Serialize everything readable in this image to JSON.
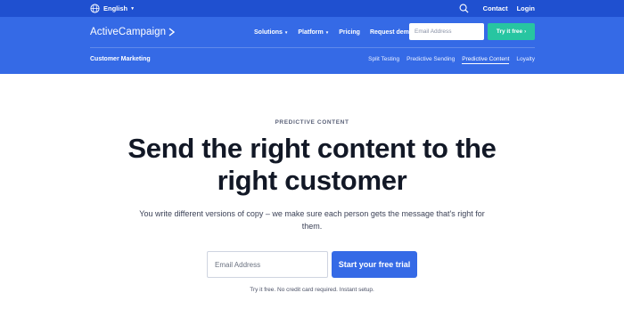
{
  "utility_bar": {
    "language": "English",
    "language_icon": "globe-icon",
    "search_icon": "search-icon",
    "links": [
      "Contact",
      "Login"
    ]
  },
  "header": {
    "logo_text": "ActiveCampaign",
    "logo_icon": "chevron-right-icon",
    "nav": [
      {
        "label": "Solutions",
        "has_dropdown": true
      },
      {
        "label": "Platform",
        "has_dropdown": true
      },
      {
        "label": "Pricing",
        "has_dropdown": false
      },
      {
        "label": "Request demo",
        "has_dropdown": false
      }
    ],
    "email_placeholder": "Email Address",
    "cta_label": "Try it free",
    "cta_arrow": "›"
  },
  "sub_header": {
    "section_title": "Customer Marketing",
    "items": [
      "Split Testing",
      "Predictive Sending",
      "Predictive Content",
      "Loyalty"
    ],
    "active_item": "Predictive Content"
  },
  "hero": {
    "eyebrow": "PREDICTIVE CONTENT",
    "headline_line1": "Send the right content to the",
    "headline_line2": "right customer",
    "subtext_line1": "You write different versions of copy – we make sure each person gets the message that's right for",
    "subtext_line2": "them.",
    "email_placeholder": "Email Address",
    "cta_label": "Start your free trial",
    "footnote": "Try it free. No credit card required. Instant setup."
  },
  "colors": {
    "header_bg": "#356ae6",
    "utility_bg": "#1f50d0",
    "accent_green": "#27c5a1",
    "cta_blue": "#356ae6",
    "headline": "#121826"
  }
}
